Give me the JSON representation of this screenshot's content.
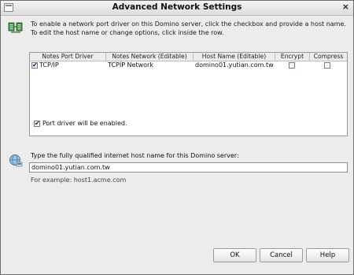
{
  "window": {
    "title": "Advanced Network Settings",
    "close_glyph": "×"
  },
  "instructions": {
    "line1": "To enable a network port driver on this Domino server, click the checkbox and provide a host name.",
    "line2": "To edit the host name or change options, click inside the row."
  },
  "table": {
    "columns": [
      "Notes Port Driver",
      "Notes Network (Editable)",
      "Host Name (Editable)",
      "Encrypt",
      "Compress"
    ],
    "rows": [
      {
        "enabled": true,
        "port_driver": "TCP/IP",
        "network": "TCPIP Network",
        "host_name": "domino01.yutian.com.tw",
        "encrypt": false,
        "compress": false
      }
    ]
  },
  "port_driver_enabled": {
    "checked": true,
    "label": "Port driver will be enabled."
  },
  "host_field": {
    "prompt": "Type the fully qualified internet host name for this Domino server:",
    "value": "domino01.yutian.com.tw",
    "example": "For example: host1.acme.com"
  },
  "buttons": {
    "ok": "OK",
    "cancel": "Cancel",
    "help": "Help"
  },
  "icons": {
    "title": "window-menu-icon",
    "network": "network-port-icon",
    "host": "globe-host-icon"
  }
}
